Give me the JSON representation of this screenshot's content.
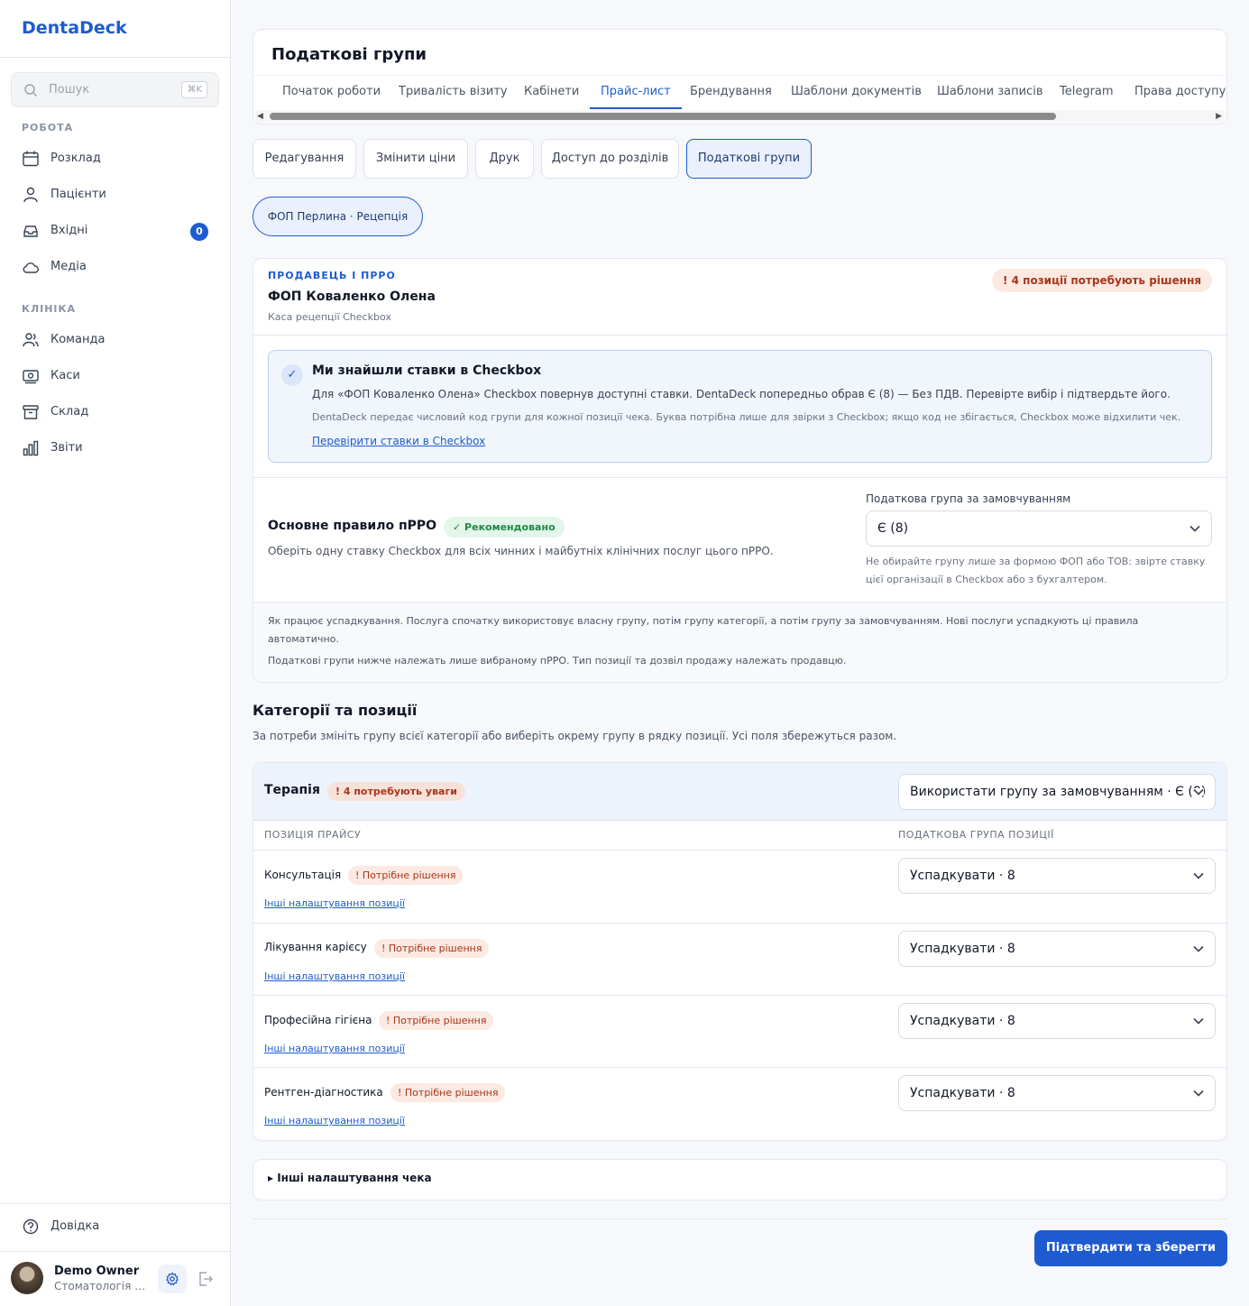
{
  "brand": "DentaDeck",
  "search": {
    "placeholder": "Пошук",
    "shortcut": "⌘K"
  },
  "sidebar": {
    "section_work": "РОБОТА",
    "work_items": [
      {
        "label": "Розклад",
        "icon": "calendar-icon"
      },
      {
        "label": "Пацієнти",
        "icon": "patients-icon"
      },
      {
        "label": "Вхідні",
        "icon": "inbox-icon",
        "badge": "0"
      },
      {
        "label": "Медіа",
        "icon": "cloud-icon"
      }
    ],
    "section_clinic": "КЛІНІКА",
    "clinic_items": [
      {
        "label": "Команда",
        "icon": "team-icon"
      },
      {
        "label": "Каси",
        "icon": "cash-register-icon"
      },
      {
        "label": "Склад",
        "icon": "archive-icon"
      },
      {
        "label": "Звіти",
        "icon": "chart-icon"
      }
    ],
    "help": "Довідка",
    "user": {
      "name": "Demo Owner",
      "org": "Стоматологія П..."
    }
  },
  "header": {
    "title": "Податкові групи",
    "tabs": [
      "Початок роботи",
      "Тривалість візиту",
      "Кабінети",
      "Прайс-лист",
      "Брендування",
      "Шаблони документів",
      "Шаблони записів",
      "Telegram",
      "Права доступу"
    ],
    "active_tab": "Прайс-лист"
  },
  "subnav": {
    "buttons": [
      "Редагування",
      "Змінити ціни",
      "Друк",
      "Доступ до розділів",
      "Податкові групи"
    ],
    "active": "Податкові групи",
    "filter_pill": "ФОП Перлина · Рецепція"
  },
  "seller": {
    "eyebrow": "ПРОДАВЕЦЬ І ПРРО",
    "name": "ФОП Коваленко Олена",
    "register": "Каса рецепції Checkbox",
    "warning": "! 4 позиції потребують рішення"
  },
  "info": {
    "title": "Ми знайшли ставки в Checkbox",
    "text": "Для «ФОП Коваленко Олена» Checkbox повернув доступні ставки. DentaDeck попередньо обрав Є (8) — Без ПДВ. Перевірте вибір і підтвердьте його.",
    "small": "DentaDeck передає числовий код групи для кожної позиції чека. Буква потрібна лише для звірки з Checkbox; якщо код не збігається, Checkbox може відхилити чек.",
    "link": "Перевірити ставки в Checkbox"
  },
  "rule": {
    "title": "Основне правило пРРО",
    "badge": "✓ Рекомендовано",
    "desc": "Оберіть одну ставку Checkbox для всіх чинних і майбутніх клінічних послуг цього пРРО.",
    "field_label": "Податкова група за замовчуванням",
    "value": "Є (8)",
    "hint": "Не обирайте групу лише за формою ФОП або ТОВ: звірте ставку цієї організації в Checkbox або з бухгалтером."
  },
  "how": {
    "line1": "Як працює успадкування. Послуга спочатку використовує власну групу, потім групу категорії, а потім групу за замовчуванням. Нові послуги успадкують ці правила автоматично.",
    "line2": "Податкові групи нижче належать лише вибраному пРРО. Тип позиції та дозвіл продажу належать продавцю."
  },
  "categories": {
    "title": "Категорії та позиції",
    "desc": "За потреби змініть групу всієї категорії або виберіть окрему групу в рядку позиції. Усі поля збережуться разом.",
    "category": {
      "name": "Терапія",
      "badge": "! 4 потребують уваги",
      "select": "Використати групу за замовчуванням · Є (8)"
    },
    "col_item": "ПОЗИЦІЯ ПРАЙСУ",
    "col_group": "ПОДАТКОВА ГРУПА ПОЗИЦІЇ",
    "rows": [
      {
        "name": "Консультація",
        "badge": "! Потрібне рішення",
        "link": "Інші налаштування позиції",
        "select": "Успадкувати · 8"
      },
      {
        "name": "Лікування карієсу",
        "badge": "! Потрібне рішення",
        "link": "Інші налаштування позиції",
        "select": "Успадкувати · 8"
      },
      {
        "name": "Професійна гігієна",
        "badge": "! Потрібне рішення",
        "link": "Інші налаштування позиції",
        "select": "Успадкувати · 8"
      },
      {
        "name": "Рентген-діагностика",
        "badge": "! Потрібне рішення",
        "link": "Інші налаштування позиції",
        "select": "Успадкувати · 8"
      }
    ]
  },
  "details": "▸ Інші налаштування чека",
  "submit": "Підтвердити та зберегти",
  "colors": {
    "accent": "#1e5bd0",
    "warning": "#a8361a",
    "success": "#1d8a43"
  }
}
